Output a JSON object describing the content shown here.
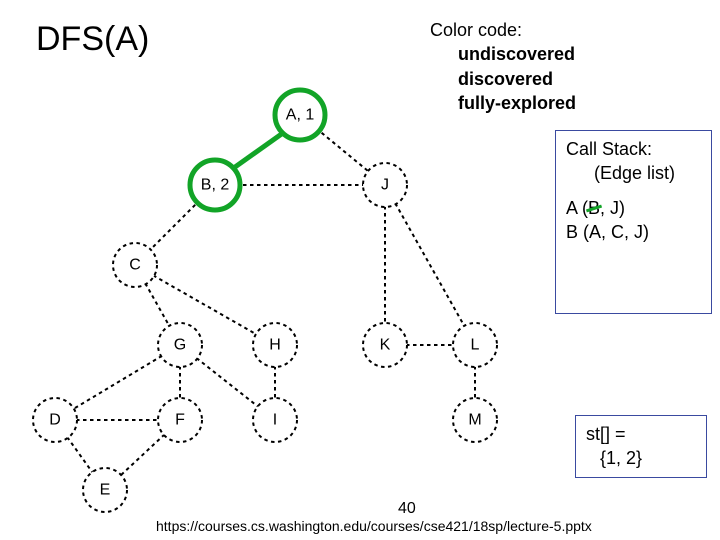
{
  "title": "DFS(A)",
  "color_code": {
    "heading": "Color code:",
    "items": [
      "undiscovered",
      "discovered",
      "fully-explored"
    ]
  },
  "call_stack": {
    "heading": "Call Stack:",
    "subheading": "(Edge list)",
    "entries": [
      {
        "prefix": "A (",
        "struck": "B",
        "suffix": ", J)"
      },
      {
        "prefix": "B (A, C, J)",
        "struck": "",
        "suffix": ""
      }
    ]
  },
  "st_array": {
    "label": "st[] =",
    "value": "{1, 2}"
  },
  "nodes": {
    "A": "A, 1",
    "B": "B, 2",
    "C": "C",
    "D": "D",
    "E": "E",
    "F": "F",
    "G": "G",
    "H": "H",
    "I": "I",
    "J": "J",
    "K": "K",
    "L": "L",
    "M": "M"
  },
  "slide_number": "40",
  "source_url": "https://courses.cs.washington.edu/courses/cse421/18sp/lecture-5.pptx",
  "chart_data": {
    "type": "graph",
    "title": "DFS(A)",
    "nodes": [
      {
        "id": "A",
        "label": "A, 1",
        "state": "discovered"
      },
      {
        "id": "B",
        "label": "B, 2",
        "state": "discovered"
      },
      {
        "id": "C",
        "label": "C",
        "state": "undiscovered"
      },
      {
        "id": "D",
        "label": "D",
        "state": "undiscovered"
      },
      {
        "id": "E",
        "label": "E",
        "state": "undiscovered"
      },
      {
        "id": "F",
        "label": "F",
        "state": "undiscovered"
      },
      {
        "id": "G",
        "label": "G",
        "state": "undiscovered"
      },
      {
        "id": "H",
        "label": "H",
        "state": "undiscovered"
      },
      {
        "id": "I",
        "label": "I",
        "state": "undiscovered"
      },
      {
        "id": "J",
        "label": "J",
        "state": "undiscovered"
      },
      {
        "id": "K",
        "label": "K",
        "state": "undiscovered"
      },
      {
        "id": "L",
        "label": "L",
        "state": "undiscovered"
      },
      {
        "id": "M",
        "label": "M",
        "state": "undiscovered"
      }
    ],
    "edges": [
      [
        "A",
        "B"
      ],
      [
        "A",
        "J"
      ],
      [
        "B",
        "C"
      ],
      [
        "B",
        "J"
      ],
      [
        "B",
        "A"
      ],
      [
        "C",
        "G"
      ],
      [
        "C",
        "H"
      ],
      [
        "G",
        "D"
      ],
      [
        "G",
        "F"
      ],
      [
        "G",
        "I"
      ],
      [
        "H",
        "I"
      ],
      [
        "D",
        "F"
      ],
      [
        "D",
        "E"
      ],
      [
        "F",
        "E"
      ],
      [
        "J",
        "K"
      ],
      [
        "J",
        "L"
      ],
      [
        "K",
        "L"
      ],
      [
        "L",
        "M"
      ]
    ],
    "call_stack": [
      "A (B, J)  — B visited",
      "B (A, C, J)"
    ],
    "st": [
      1,
      2
    ]
  }
}
